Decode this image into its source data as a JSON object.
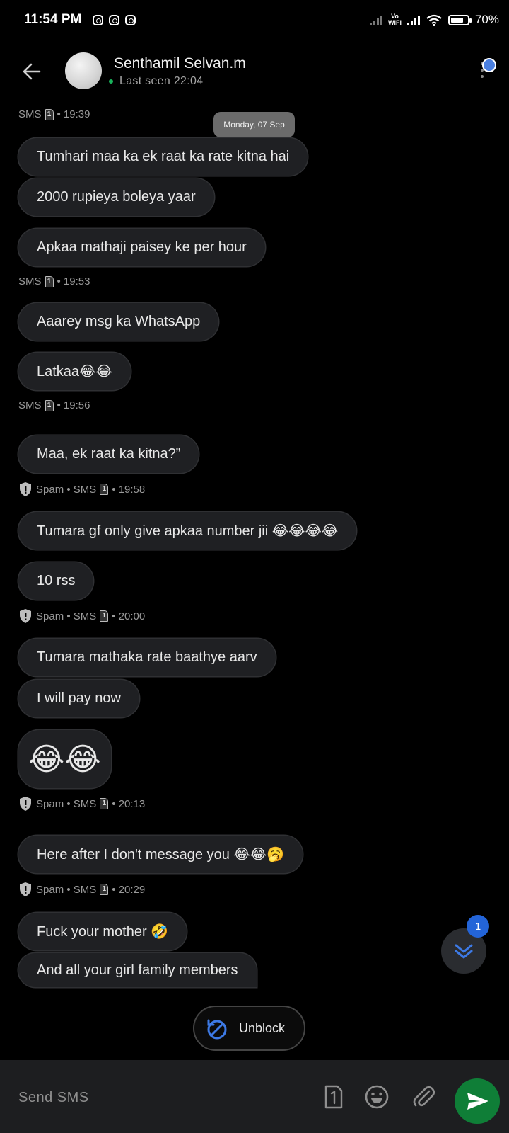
{
  "status_bar": {
    "time": "11:54 PM",
    "vowifi_line1": "Vo",
    "vowifi_line2": "WiFi",
    "battery": "70%"
  },
  "header": {
    "contact_name": "Senthamil Selvan.m",
    "last_seen": "Last seen 22:04"
  },
  "date_chip": "Monday, 07 Sep",
  "sim_slot": "1",
  "groups": [
    {
      "meta": "SMS",
      "time": "• 19:39",
      "spam": false
    },
    {
      "meta": "SMS",
      "time": "• 19:53",
      "spam": false
    },
    {
      "meta": "SMS",
      "time": "• 19:56",
      "spam": false
    },
    {
      "meta": "Spam • SMS",
      "time": "• 19:58",
      "spam": true
    },
    {
      "meta": "Spam • SMS",
      "time": "• 20:00",
      "spam": true
    },
    {
      "meta": "Spam • SMS",
      "time": "• 20:13",
      "spam": true
    },
    {
      "meta": "Spam • SMS",
      "time": "• 20:29",
      "spam": true
    }
  ],
  "messages": [
    "Tumhari maa ka ek raat ka rate kitna hai",
    "2000 rupieya boleya yaar",
    "Apkaa mathaji paisey ke per hour",
    "Aaarey msg ka WhatsApp",
    "Latkaa😂😂",
    "Maa, ek raat ka kitna?”",
    "Tumara gf only give apkaa number jii 😂😂😂😂",
    "10 rss",
    "Tumara mathaka rate baathye aarv",
    "I will pay now",
    "😂😂",
    "Here after I don't message you 😂😂🥱",
    "Fuck your mother 🤣",
    "And all your girl family members"
  ],
  "unread_count": "1",
  "unblock_label": "Unblock",
  "composer": {
    "placeholder": "Send SMS"
  },
  "icons": {
    "back": "back-arrow-icon",
    "more": "more-vert-icon",
    "shield": "shield-alert-icon",
    "sim": "sim-card-icon",
    "scroll_down": "double-chevron-down-icon",
    "unblock": "block-icon",
    "emoji": "emoji-icon",
    "attach": "paperclip-icon",
    "send": "send-icon"
  },
  "colors": {
    "accent_blue": "#2364d8",
    "send_green": "#0f7e37",
    "online_green": "#19b35b",
    "bubble_bg": "#1f2023"
  }
}
